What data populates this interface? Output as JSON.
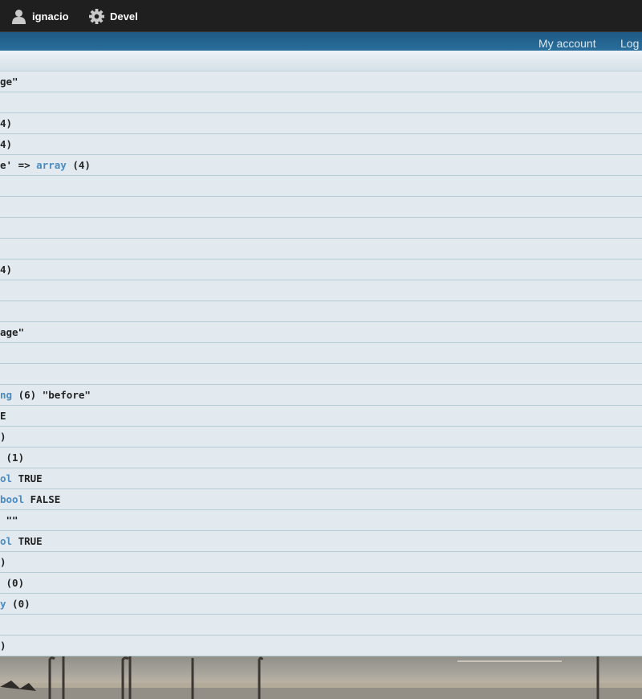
{
  "toolbar": {
    "user_label": "ignacio",
    "devel_label": "Devel",
    "user_icon": "person-icon",
    "devel_icon": "gear-icon"
  },
  "secondary": {
    "my_account": "My account",
    "logout": "Log"
  },
  "colors": {
    "toolbar_bg": "#1f1f1f",
    "secondary_bg": "#26648f",
    "panel_bg": "#e2eaf0",
    "keyword": "#4a8bc2"
  },
  "dump_rows": [
    [
      {
        "t": "ge\""
      }
    ],
    [],
    [
      {
        "t": "4)"
      }
    ],
    [
      {
        "t": "4)"
      }
    ],
    [
      {
        "t": "e' => "
      },
      {
        "t": "array",
        "kw": true
      },
      {
        "t": " (4)"
      }
    ],
    [],
    [],
    [],
    [],
    [
      {
        "t": "4)"
      }
    ],
    [],
    [],
    [
      {
        "t": "age\""
      }
    ],
    [],
    [],
    [
      {
        "t": "ng",
        "kw": true
      },
      {
        "t": " (6) \"before\""
      }
    ],
    [
      {
        "t": "E"
      }
    ],
    [
      {
        "t": ")"
      }
    ],
    [
      {
        "t": " (1)"
      }
    ],
    [
      {
        "t": "ol",
        "kw": true
      },
      {
        "t": " TRUE"
      }
    ],
    [
      {
        "t": "bool",
        "kw": true
      },
      {
        "t": " FALSE"
      }
    ],
    [
      {
        "t": " \"\""
      }
    ],
    [
      {
        "t": "ol",
        "kw": true
      },
      {
        "t": " TRUE"
      }
    ],
    [
      {
        "t": ")"
      }
    ],
    [
      {
        "t": " (0)"
      }
    ],
    [
      {
        "t": "y",
        "kw": true
      },
      {
        "t": " (0)"
      }
    ],
    [],
    [
      {
        "t": ")"
      }
    ]
  ]
}
